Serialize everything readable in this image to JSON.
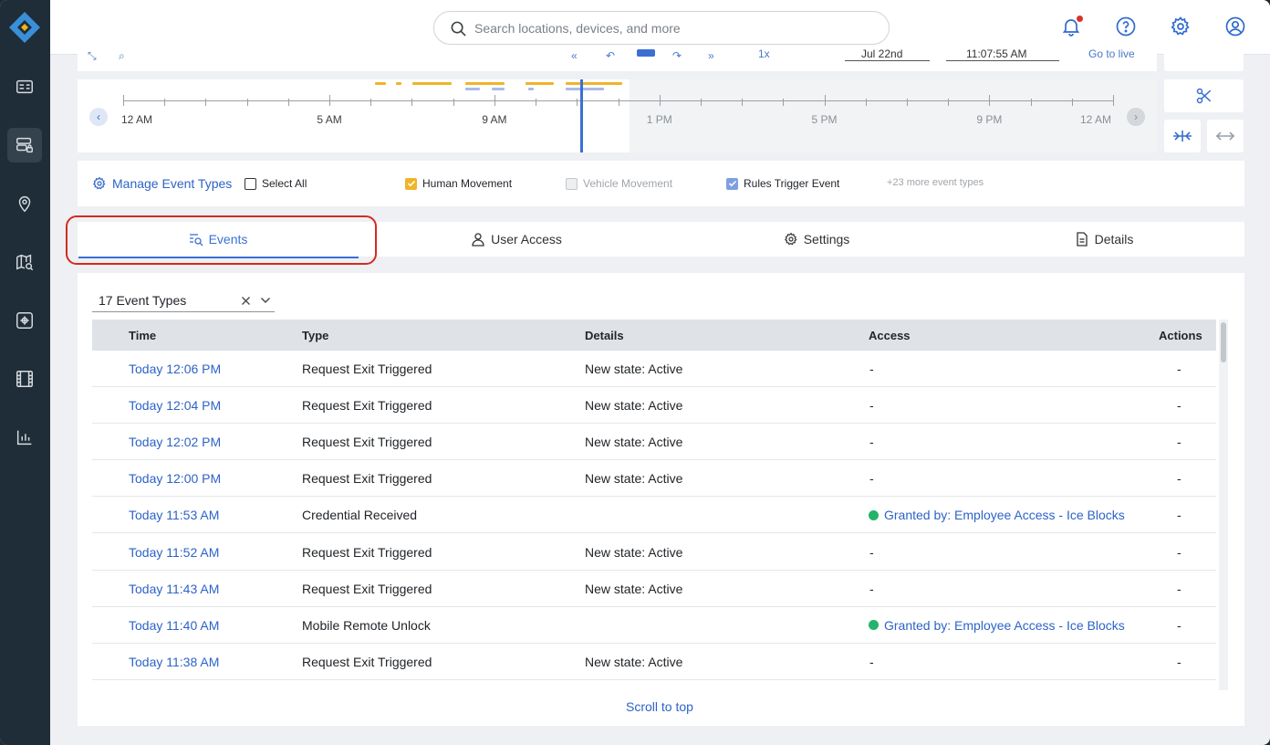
{
  "search": {
    "placeholder": "Search locations, devices, and more"
  },
  "timeline": {
    "tick_labels": [
      "12 AM",
      "5 AM",
      "9 AM",
      "1 PM",
      "5 PM",
      "9 PM",
      "12 AM"
    ],
    "controls": {
      "speed": "1x",
      "date": "Jul 22nd",
      "time": "11:07:55 AM",
      "go_live": "Go to live"
    }
  },
  "filters": {
    "manage_label": "Manage Event Types",
    "select_all": "Select All",
    "human_movement": "Human Movement",
    "vehicle_movement": "Vehicle Movement",
    "rules_trigger": "Rules Trigger Event",
    "more": "+23 more event types"
  },
  "tabs": [
    {
      "label": "Events"
    },
    {
      "label": "User Access"
    },
    {
      "label": "Settings"
    },
    {
      "label": "Details"
    }
  ],
  "event_type_select": {
    "value": "17 Event Types"
  },
  "table": {
    "headers": {
      "time": "Time",
      "type": "Type",
      "details": "Details",
      "access": "Access",
      "actions": "Actions"
    },
    "rows": [
      {
        "time": "Today 12:06 PM",
        "type": "Request Exit Triggered",
        "details": "New state: Active",
        "access": "-",
        "granted": false,
        "actions": "-"
      },
      {
        "time": "Today 12:04 PM",
        "type": "Request Exit Triggered",
        "details": "New state: Active",
        "access": "-",
        "granted": false,
        "actions": "-"
      },
      {
        "time": "Today 12:02 PM",
        "type": "Request Exit Triggered",
        "details": "New state: Active",
        "access": "-",
        "granted": false,
        "actions": "-"
      },
      {
        "time": "Today 12:00 PM",
        "type": "Request Exit Triggered",
        "details": "New state: Active",
        "access": "-",
        "granted": false,
        "actions": "-"
      },
      {
        "time": "Today 11:53 AM",
        "type": "Credential Received",
        "details": "",
        "access": "Granted by: Employee Access - Ice Blocks",
        "granted": true,
        "actions": "-"
      },
      {
        "time": "Today 11:52 AM",
        "type": "Request Exit Triggered",
        "details": "New state: Active",
        "access": "-",
        "granted": false,
        "actions": "-"
      },
      {
        "time": "Today 11:43 AM",
        "type": "Request Exit Triggered",
        "details": "New state: Active",
        "access": "-",
        "granted": false,
        "actions": "-"
      },
      {
        "time": "Today 11:40 AM",
        "type": "Mobile Remote Unlock",
        "details": "",
        "access": "Granted by: Employee Access - Ice Blocks",
        "granted": true,
        "actions": "-"
      },
      {
        "time": "Today 11:38 AM",
        "type": "Request Exit Triggered",
        "details": "New state: Active",
        "access": "-",
        "granted": false,
        "actions": "-"
      }
    ]
  },
  "scroll_to_top": "Scroll to top",
  "colors": {
    "accent": "#3b6fd4",
    "human": "#f0b429",
    "rules": "#a9bbe8",
    "granted": "#23b46a",
    "highlight": "#d62a20"
  }
}
